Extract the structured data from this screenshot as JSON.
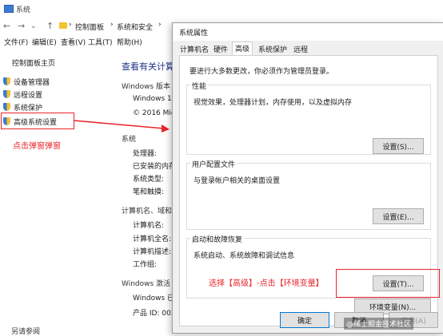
{
  "window": {
    "title": "系统"
  },
  "address": {
    "crumbs": [
      "控制面板",
      "系统和安全",
      "系统"
    ]
  },
  "menu": [
    "文件(F)",
    "编辑(E)",
    "查看(V)",
    "工具(T)",
    "帮助(H)"
  ],
  "sidebar": {
    "home": "控制面板主页",
    "items": [
      "设备管理器",
      "远程设置",
      "系统保护",
      "高级系统设置"
    ]
  },
  "main": {
    "heading": "查看有关计算",
    "windows_edition_label": "Windows 版本",
    "windows_edition": "Windows 10",
    "copyright": "© 2016 Micr",
    "system_label": "系统",
    "processor": "处理器:",
    "ram": "已安装的内存",
    "system_type": "系统类型:",
    "pen_touch": "笔和触摸:",
    "computer_section": "计算机名、域和工",
    "computer_name": "计算机名:",
    "full_name": "计算机全名:",
    "description": "计算机描述:",
    "workgroup": "工作组:",
    "activation": "Windows 激活",
    "activation_value": "Windows 已",
    "product_id": "产品 ID: 003",
    "see_also": "另请参阅"
  },
  "dialog": {
    "title": "系统属性",
    "tabs": [
      "计算机名",
      "硬件",
      "高级",
      "系统保护",
      "远程"
    ],
    "active_tab": "高级",
    "admin_note": "要进行大多数更改，你必须作为管理员登录。",
    "groups": [
      {
        "label": "性能",
        "desc": "视觉效果，处理器计划，内存使用，以及虚拟内存",
        "button": "设置(S)..."
      },
      {
        "label": "用户配置文件",
        "desc": "与登录帐户相关的桌面设置",
        "button": "设置(E)..."
      },
      {
        "label": "启动和故障恢复",
        "desc": "系统启动、系统故障和调试信息",
        "button": "设置(T)..."
      }
    ],
    "env_button": "环境变量(N)...",
    "ok": "确定",
    "cancel": "取消",
    "apply": "应用(A)"
  },
  "annotations": {
    "left": "点击弹窗弹窗",
    "right": "选择【高级】-点击【环境变量】"
  },
  "watermark": "@稀土掘金技术社区",
  "colors": {
    "annotation_red": "#e8252a",
    "focus_blue": "#0078d7"
  }
}
